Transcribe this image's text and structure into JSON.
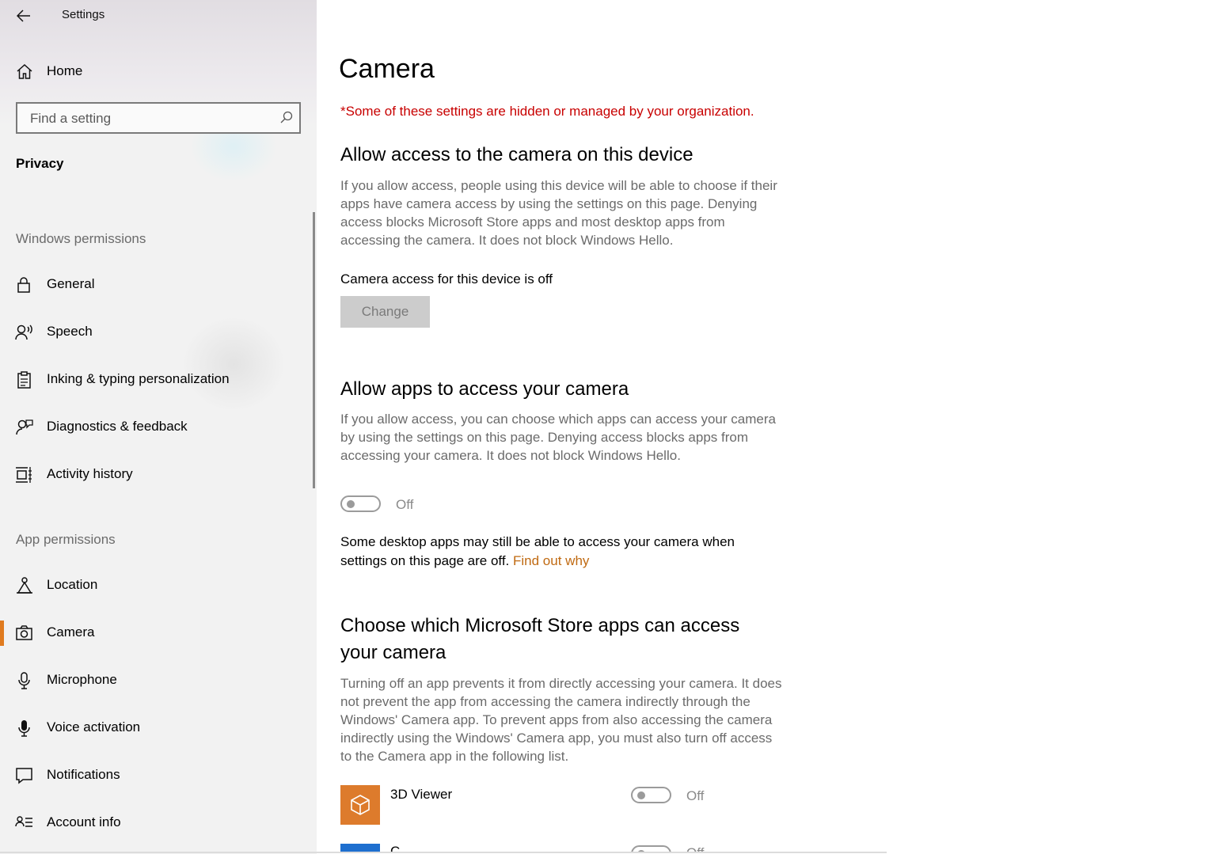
{
  "window": {
    "title": "Settings"
  },
  "colors": {
    "accent": "#e07b1f",
    "warning": "#c80000",
    "link": "#c06a12",
    "tile_3d_viewer": "#dd7b2c",
    "tile_next": "#1e6fcf"
  },
  "sidebar": {
    "home_label": "Home",
    "search_placeholder": "Find a setting",
    "category": "Privacy",
    "windows_permissions_heading": "Windows permissions",
    "windows_permissions": [
      {
        "label": "General",
        "icon": "lock-icon"
      },
      {
        "label": "Speech",
        "icon": "speech-icon"
      },
      {
        "label": "Inking & typing personalization",
        "icon": "clipboard-icon"
      },
      {
        "label": "Diagnostics & feedback",
        "icon": "feedback-icon"
      },
      {
        "label": "Activity history",
        "icon": "timeline-icon"
      }
    ],
    "app_permissions_heading": "App permissions",
    "app_permissions": [
      {
        "label": "Location",
        "icon": "location-icon"
      },
      {
        "label": "Camera",
        "icon": "camera-icon",
        "selected": true
      },
      {
        "label": "Microphone",
        "icon": "microphone-icon"
      },
      {
        "label": "Voice activation",
        "icon": "voice-activation-icon"
      },
      {
        "label": "Notifications",
        "icon": "notifications-icon"
      },
      {
        "label": "Account info",
        "icon": "account-info-icon"
      }
    ]
  },
  "main": {
    "title": "Camera",
    "managed_note": "*Some of these settings are hidden or managed by your organization.",
    "device_section": {
      "heading": "Allow access to the camera on this device",
      "description": "If you allow access, people using this device will be able to choose if their apps have camera access by using the settings on this page. Denying access blocks Microsoft Store apps and most desktop apps from accessing the camera. It does not block Windows Hello.",
      "status": "Camera access for this device is off",
      "change_button": "Change"
    },
    "apps_section": {
      "heading": "Allow apps to access your camera",
      "description": "If you allow access, you can choose which apps can access your camera by using the settings on this page. Denying access blocks apps from accessing your camera. It does not block Windows Hello.",
      "toggle_state": "Off",
      "desktop_note": "Some desktop apps may still be able to access your camera when settings on this page are off.",
      "find_out_why": "Find out why"
    },
    "store_section": {
      "heading": "Choose which Microsoft Store apps can access your camera",
      "description": "Turning off an app prevents it from directly accessing your camera. It does not prevent the app from accessing the camera indirectly through the Windows' Camera app. To prevent apps from also accessing the camera indirectly using the Windows' Camera app, you must also turn off access to the Camera app in the following list.",
      "apps": [
        {
          "name": "3D Viewer",
          "state": "Off",
          "icon": "cube-icon"
        },
        {
          "name": "C",
          "state": "Off",
          "icon": "app-icon"
        }
      ]
    }
  }
}
